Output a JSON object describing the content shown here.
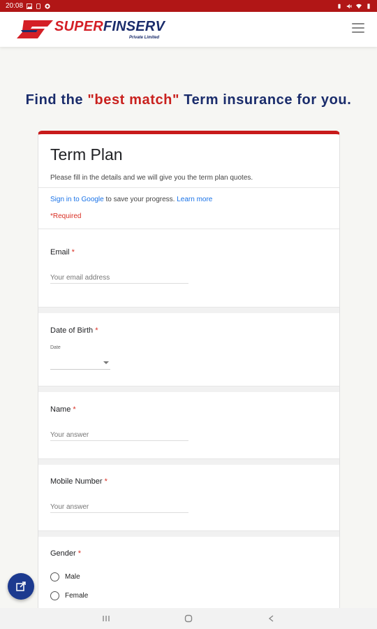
{
  "status_bar": {
    "time": "20:08"
  },
  "brand": {
    "name_first": "SUPER",
    "name_rest": "FINSERV",
    "subtitle": "Private Limited"
  },
  "headline": {
    "prefix": "Find the ",
    "highlight": "\"best match\"",
    "suffix": " Term insurance for you."
  },
  "form": {
    "title": "Term Plan",
    "description": "Please fill in the details and we will give you the term plan quotes.",
    "signin_link": "Sign in to Google",
    "signin_text": " to save your progress. ",
    "learn_more": "Learn more",
    "required_note": "*Required",
    "questions": {
      "email": {
        "label": "Email",
        "star": "*",
        "placeholder": "Your email address"
      },
      "dob": {
        "label": "Date of Birth",
        "star": "*",
        "date_label": "Date"
      },
      "name": {
        "label": "Name",
        "star": "*",
        "placeholder": "Your answer"
      },
      "mobile": {
        "label": "Mobile Number",
        "star": "*",
        "placeholder": "Your answer"
      },
      "gender": {
        "label": "Gender",
        "star": "*",
        "options": [
          "Male",
          "Female"
        ]
      }
    }
  },
  "colors": {
    "accent": "#c81b1b",
    "brand_navy": "#1a2c6b",
    "link": "#1a73e8",
    "status_bar": "#b11616"
  }
}
